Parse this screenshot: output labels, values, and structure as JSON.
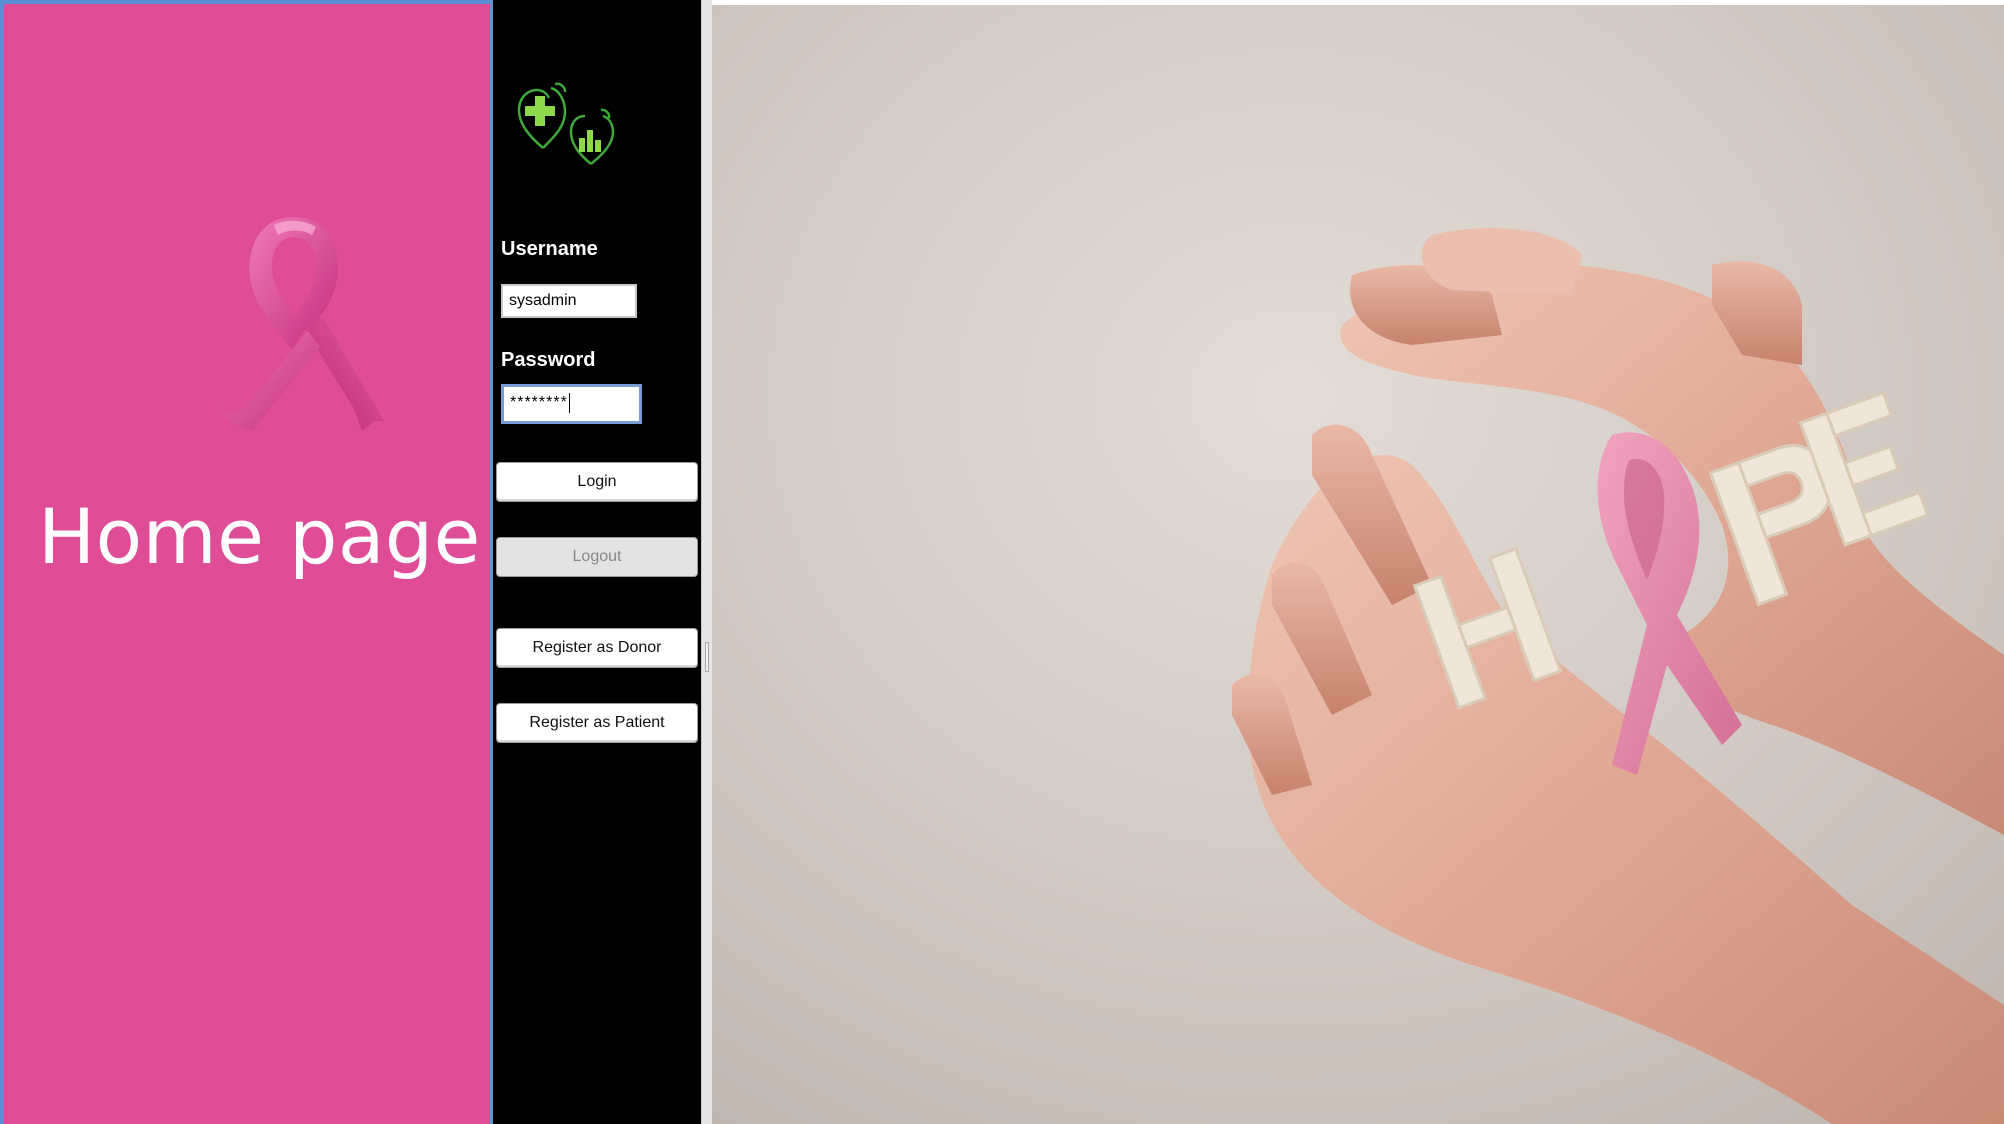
{
  "left_panel": {
    "title": "Home page",
    "icon": "pink-ribbon-icon",
    "background_color": "#de4d96"
  },
  "login": {
    "logo_icon": "health-hearts-logo-icon",
    "username_label": "Username",
    "username_value": "sysadmin",
    "password_label": "Password",
    "password_value": "********",
    "login_button": "Login",
    "logout_button": "Logout",
    "register_donor_button": "Register as Donor",
    "register_patient_button": "Register as Patient"
  },
  "photo": {
    "word": "HOPE",
    "letters_shown": [
      "H",
      "P",
      "E"
    ],
    "description_icon": "hands-holding-ribbon-photo"
  }
}
